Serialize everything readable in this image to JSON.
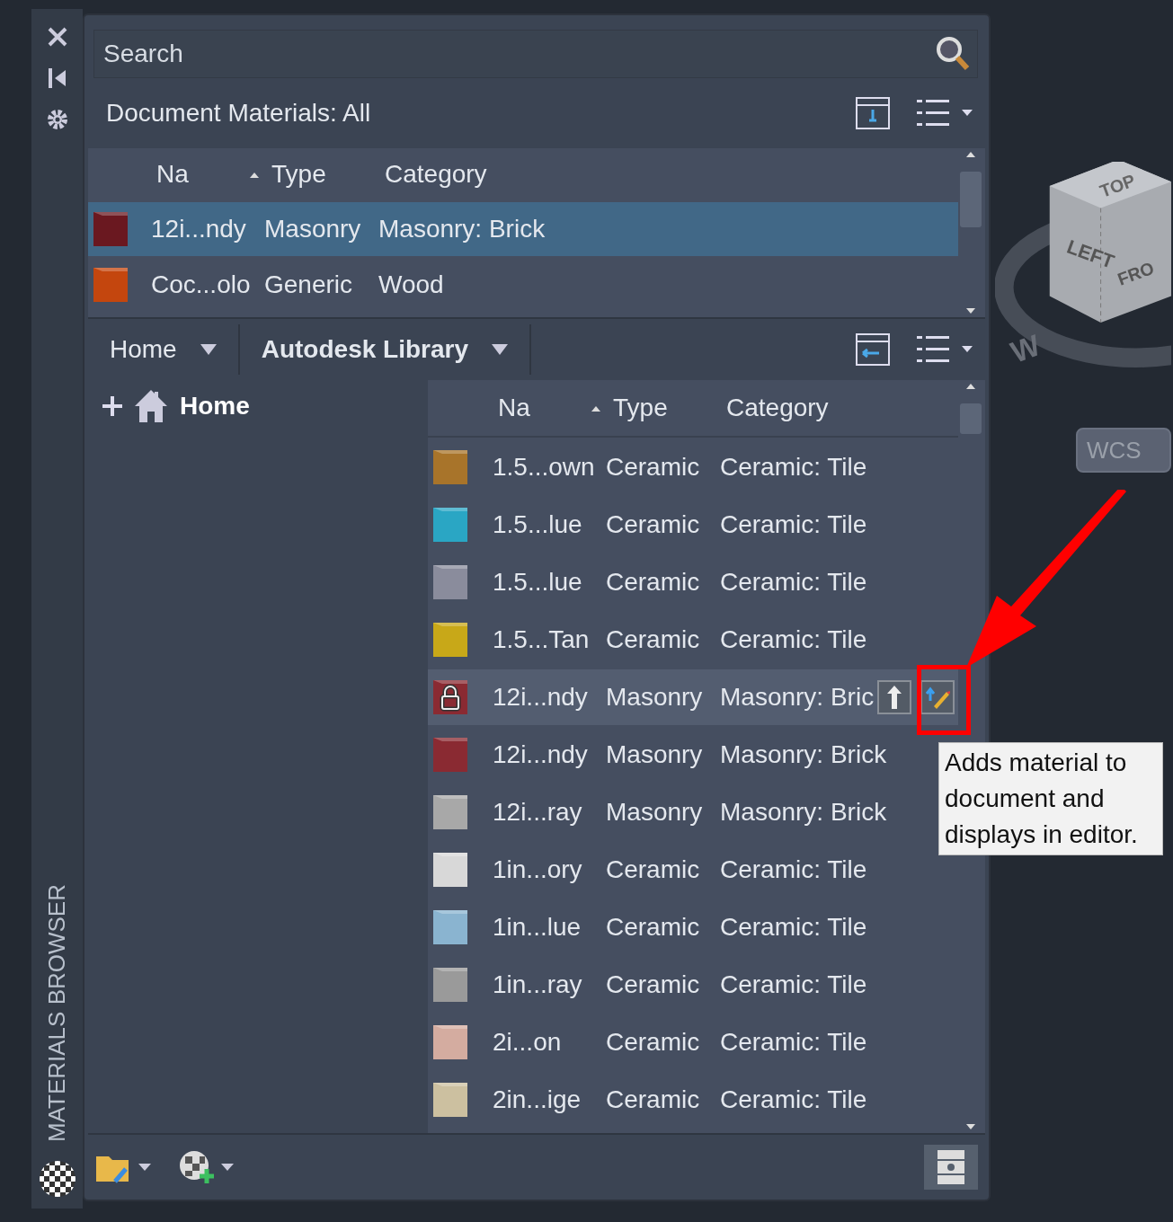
{
  "side_strip": {
    "title": "MATERIALS BROWSER"
  },
  "search": {
    "placeholder": "Search"
  },
  "document_materials": {
    "title": "Document Materials: All",
    "columns": [
      "Na",
      "Type",
      "Category"
    ],
    "rows": [
      {
        "name": "12i...ndy",
        "type": "Masonry",
        "category": "Masonry: Brick",
        "color": "#6a1820",
        "selected": true
      },
      {
        "name": "Coc...olo",
        "type": "Generic",
        "category": "Wood",
        "color": "#c4460e",
        "selected": false
      }
    ]
  },
  "library_tabs": [
    {
      "label": "Home",
      "selected": false
    },
    {
      "label": "Autodesk Library",
      "selected": true
    }
  ],
  "tree": {
    "items": [
      {
        "label": "Home",
        "expanded": false
      }
    ]
  },
  "library": {
    "columns": [
      "Na",
      "Type",
      "Category"
    ],
    "rows": [
      {
        "name": "1.5...own",
        "type": "Ceramic",
        "category": "Ceramic: Tile",
        "color": "#a8742a",
        "selected": false,
        "locked": false
      },
      {
        "name": "1.5...lue",
        "type": "Ceramic",
        "category": "Ceramic: Tile",
        "color": "#2aa6c4",
        "selected": false,
        "locked": false
      },
      {
        "name": "1.5...lue",
        "type": "Ceramic",
        "category": "Ceramic: Tile",
        "color": "#8a8c9c",
        "selected": false,
        "locked": false
      },
      {
        "name": "1.5...Tan",
        "type": "Ceramic",
        "category": "Ceramic: Tile",
        "color": "#c8a818",
        "selected": false,
        "locked": false
      },
      {
        "name": "12i...ndy",
        "type": "Masonry",
        "category": "Masonry: Bric",
        "color": "#8a2a32",
        "selected": true,
        "locked": true
      },
      {
        "name": "12i...ndy",
        "type": "Masonry",
        "category": "Masonry: Brick",
        "color": "#8a2a32",
        "selected": false,
        "locked": false
      },
      {
        "name": "12i...ray",
        "type": "Masonry",
        "category": "Masonry: Brick",
        "color": "#a8a8a8",
        "selected": false,
        "locked": false
      },
      {
        "name": "1in...ory",
        "type": "Ceramic",
        "category": "Ceramic: Tile",
        "color": "#d8d8d8",
        "selected": false,
        "locked": false
      },
      {
        "name": "1in...lue",
        "type": "Ceramic",
        "category": "Ceramic: Tile",
        "color": "#8ab4d0",
        "selected": false,
        "locked": false
      },
      {
        "name": "1in...ray",
        "type": "Ceramic",
        "category": "Ceramic: Tile",
        "color": "#9a9a9a",
        "selected": false,
        "locked": false
      },
      {
        "name": "2i...on",
        "type": "Ceramic",
        "category": "Ceramic: Tile",
        "color": "#d4aca0",
        "selected": false,
        "locked": false
      },
      {
        "name": "2in...ige",
        "type": "Ceramic",
        "category": "Ceramic: Tile",
        "color": "#ccc0a0",
        "selected": false,
        "locked": false
      }
    ]
  },
  "tooltip": {
    "text": "Adds material to document and displays in editor."
  },
  "viewport": {
    "cube_faces": [
      "TOP",
      "LEFT",
      "FRO"
    ],
    "compass": [
      "W"
    ],
    "ucs_menu": "WCS"
  }
}
